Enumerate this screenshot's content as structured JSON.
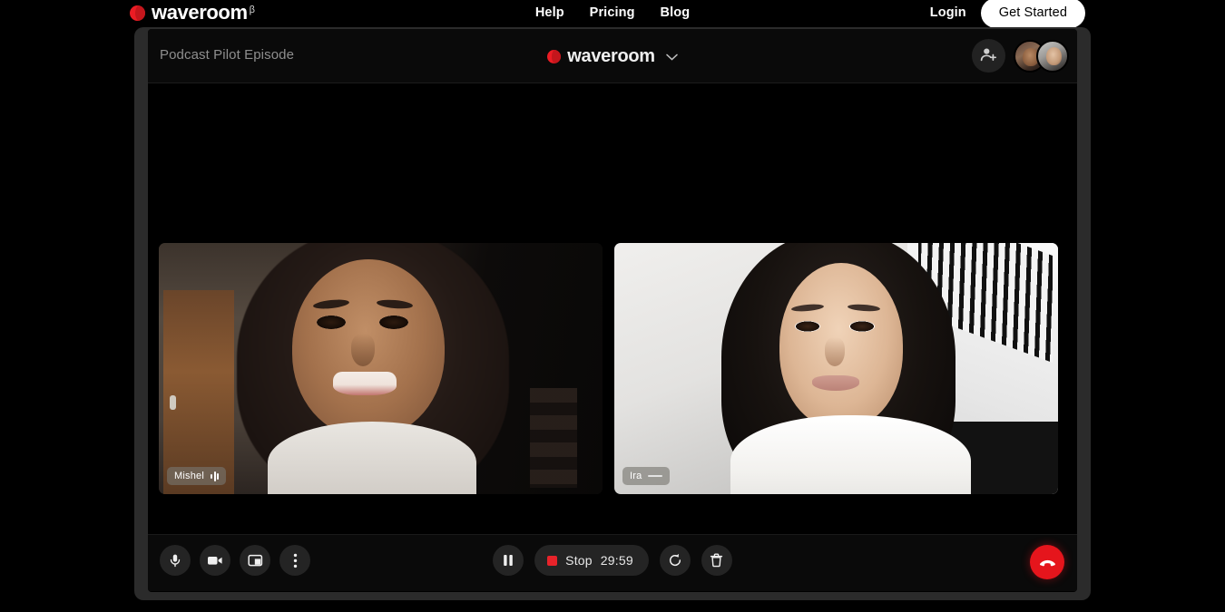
{
  "site_nav": {
    "brand": {
      "name": "waveroom",
      "beta": "β",
      "logo_icon": "waveroom-dot-logo"
    },
    "links": [
      {
        "label": "Help"
      },
      {
        "label": "Pricing"
      },
      {
        "label": "Blog"
      }
    ],
    "login_label": "Login",
    "cta_label": "Get Started"
  },
  "app": {
    "header": {
      "session_title": "Podcast Pilot Episode",
      "brand_name": "waveroom",
      "chevron_icon": "chevron-down-icon",
      "add_person_icon": "add-person-icon",
      "participants": [
        {
          "name": "Mishel"
        },
        {
          "name": "Ira"
        }
      ]
    },
    "stage": {
      "tiles": [
        {
          "name": "Mishel",
          "mic_state": "active",
          "level_icon": "audio-level-icon"
        },
        {
          "name": "Ira",
          "mic_state": "muted",
          "level_icon": "audio-level-flat-icon"
        }
      ]
    },
    "controls": {
      "left": [
        {
          "name": "microphone",
          "icon": "microphone-icon"
        },
        {
          "name": "camera",
          "icon": "video-camera-icon"
        },
        {
          "name": "share-screen",
          "icon": "screen-share-icon"
        },
        {
          "name": "more-options",
          "icon": "more-vertical-icon"
        }
      ],
      "pause_icon": "pause-icon",
      "stop_label": "Stop",
      "timer": "29:59",
      "record_dot_color": "#E8232A",
      "restart_icon": "restart-icon",
      "delete_icon": "trash-icon",
      "hangup_icon": "hangup-phone-icon",
      "hangup_color": "#E5151C"
    }
  },
  "theme": {
    "background": "#000000",
    "brand_red": "#EB1C24",
    "panel": "#0a0a0a",
    "shell": "#2b2b2b",
    "button": "#242424",
    "muted_text": "#8e8e8e"
  }
}
